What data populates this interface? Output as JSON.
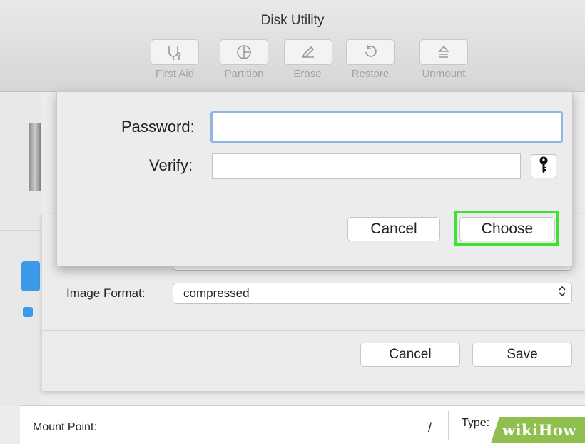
{
  "window": {
    "title": "Disk Utility"
  },
  "toolbar": {
    "items": [
      {
        "label": "First Aid",
        "icon": "stethoscope-icon"
      },
      {
        "label": "Partition",
        "icon": "pie-chart-icon"
      },
      {
        "label": "Erase",
        "icon": "eraser-icon"
      },
      {
        "label": "Restore",
        "icon": "restore-arrow-icon"
      },
      {
        "label": "Unmount",
        "icon": "eject-icon"
      }
    ]
  },
  "password_dialog": {
    "password_label": "Password:",
    "password_value": "",
    "verify_label": "Verify:",
    "verify_value": "",
    "key_icon": "key-icon",
    "cancel_label": "Cancel",
    "choose_label": "Choose",
    "highlight_color": "#3fe22f"
  },
  "save_sheet": {
    "image_format_label": "Image Format:",
    "image_format_value": "compressed",
    "cancel_label": "Cancel",
    "save_label": "Save"
  },
  "info": {
    "mount_point_label": "Mount Point:",
    "mount_point_value": "/",
    "type_label": "Type:"
  },
  "watermark": {
    "text": "wikiHow",
    "color": "#8fbf4e"
  }
}
